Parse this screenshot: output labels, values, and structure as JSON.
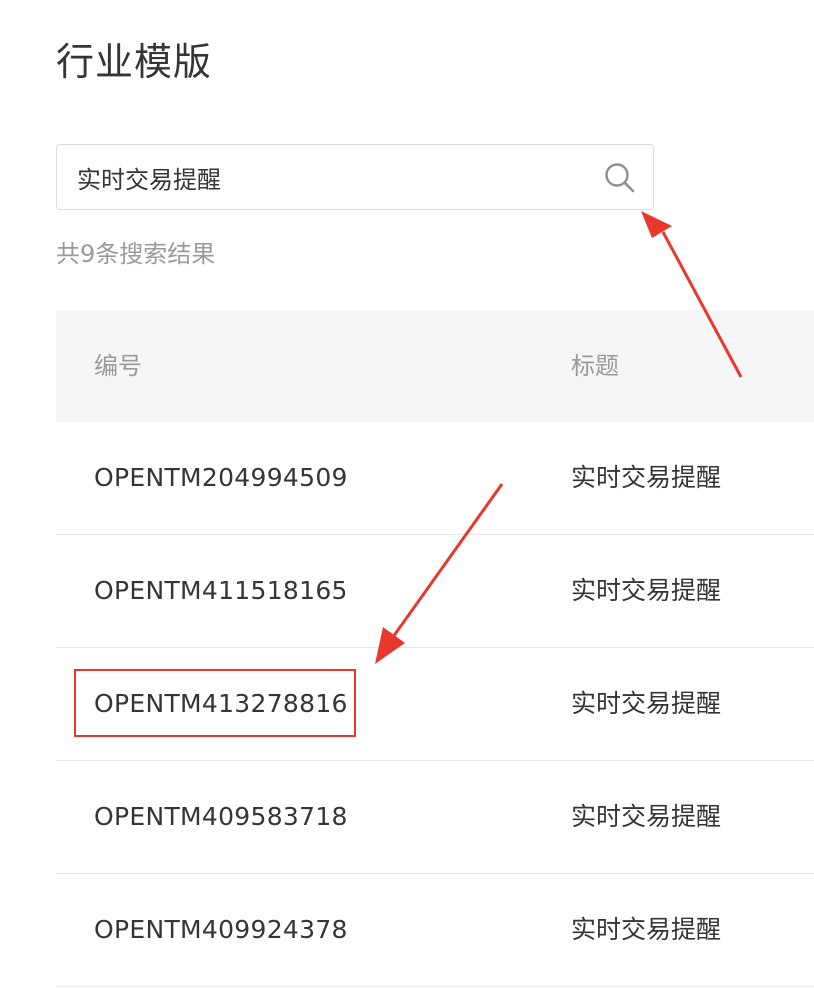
{
  "page": {
    "title": "行业模版"
  },
  "search": {
    "value": "实时交易提醒",
    "icon": "search-icon"
  },
  "results": {
    "count_text": "共9条搜索结果"
  },
  "table": {
    "headers": {
      "id": "编号",
      "title": "标题"
    },
    "rows": [
      {
        "id": "OPENTM204994509",
        "title": "实时交易提醒"
      },
      {
        "id": "OPENTM411518165",
        "title": "实时交易提醒"
      },
      {
        "id": "OPENTM413278816",
        "title": "实时交易提醒"
      },
      {
        "id": "OPENTM409583718",
        "title": "实时交易提醒"
      },
      {
        "id": "OPENTM409924378",
        "title": "实时交易提醒"
      }
    ]
  },
  "annotations": {
    "color": "#e8382c",
    "highlighted_row_index": 2
  }
}
